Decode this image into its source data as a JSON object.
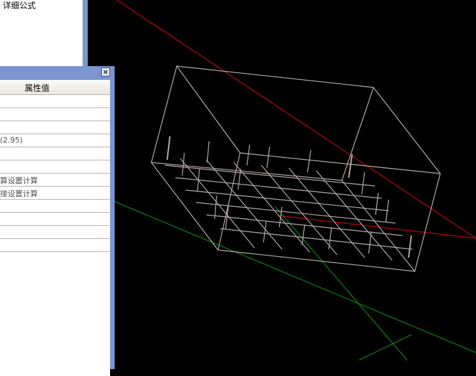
{
  "formula_dialog": {
    "text": "详细公式"
  },
  "property_panel": {
    "close_glyph": "×",
    "header": "属性值",
    "rows": [
      "",
      "",
      "",
      "(2.95)",
      "",
      "",
      "算设置计算",
      "接设置计算",
      "",
      "",
      "",
      ""
    ]
  },
  "viewport": {
    "background": "#000000",
    "axis_colors": {
      "x": "#e00000",
      "y": "#00a000"
    },
    "wireframe_color": "#b7aca8",
    "icon": "wireframe-box-icon"
  }
}
